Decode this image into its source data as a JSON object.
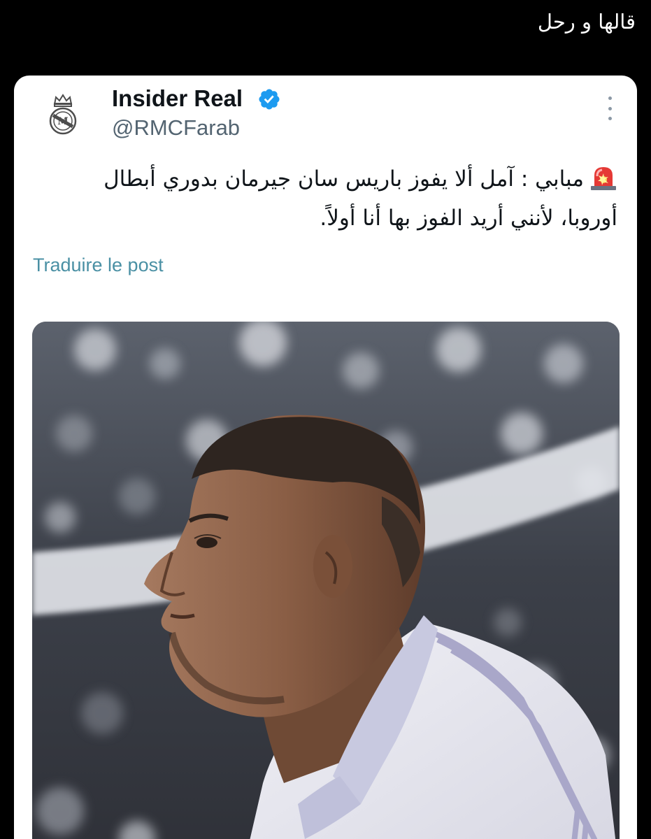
{
  "caption": "قالها و رحل",
  "post": {
    "author_name": "Insider Real",
    "handle": "@RMCFarab",
    "text_line1": "مبابي : آمل ألا يفوز باريس سان جيرمان بدوري أبطال",
    "text_line2": "أوروبا، لأنني أريد الفوز بها أنا أولاً.",
    "translate_label": "Traduire le post",
    "verified_icon": "verified-badge-icon",
    "alert_icon": "rotating-light-icon",
    "more_icon": "more-vertical-icon"
  },
  "colors": {
    "background": "#000000",
    "card": "#ffffff",
    "name": "#0f1419",
    "handle": "#536471",
    "verified": "#1d9bf0",
    "translate": "#4a90a4"
  }
}
